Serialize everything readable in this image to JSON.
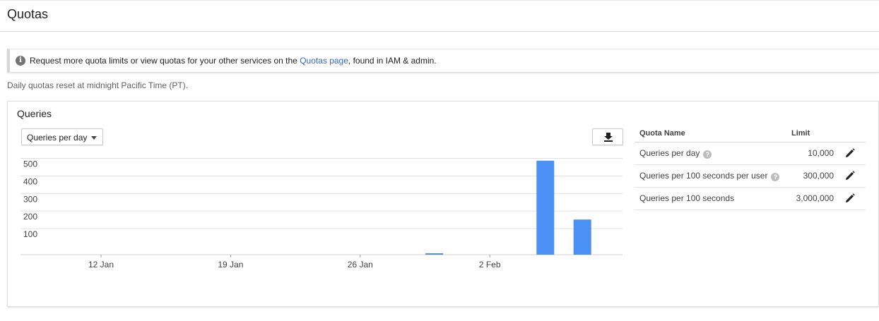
{
  "page": {
    "title": "Quotas"
  },
  "banner": {
    "icon": "info-icon",
    "text_before": "Request more quota limits or view quotas for your other services on the ",
    "link_text": "Quotas page",
    "text_after": ", found in IAM & admin."
  },
  "reset_note": "Daily quotas reset at midnight Pacific Time (PT).",
  "card": {
    "title": "Queries",
    "metric_select": {
      "selected": "Queries per day"
    },
    "download_icon": "download-icon"
  },
  "colors": {
    "bar": "#4a90f5",
    "link": "#3367d6",
    "grid": "#e0e0e0"
  },
  "chart_data": {
    "type": "bar",
    "x_tick_labels": [
      "12 Jan",
      "19 Jan",
      "26 Jan",
      "2 Feb"
    ],
    "y_tick_labels": [
      "100",
      "200",
      "300",
      "400",
      "500"
    ],
    "ylim": [
      0,
      550
    ],
    "grid": true,
    "series": [
      {
        "values": [
          {
            "x": "2019-01-30",
            "y": 8
          },
          {
            "x": "2019-02-05",
            "y": 535
          },
          {
            "x": "2019-02-07",
            "y": 200
          }
        ]
      }
    ]
  },
  "quota_table": {
    "headers": {
      "name": "Quota Name",
      "limit": "Limit"
    },
    "rows": [
      {
        "name": "Queries per day",
        "limit": "10,000",
        "help": true
      },
      {
        "name": "Queries per 100 seconds per user",
        "limit": "300,000",
        "help": true
      },
      {
        "name": "Queries per 100 seconds",
        "limit": "3,000,000",
        "help": false
      }
    ]
  }
}
